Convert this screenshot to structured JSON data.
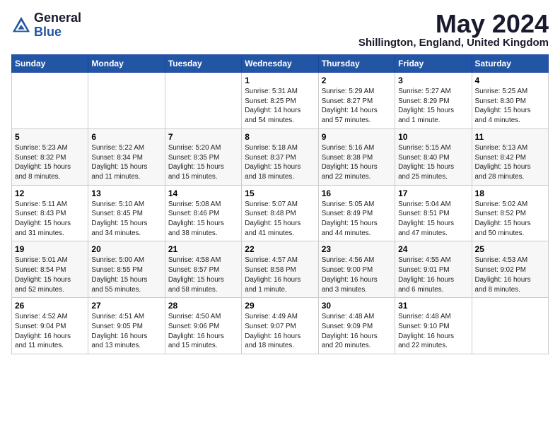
{
  "logo": {
    "general": "General",
    "blue": "Blue"
  },
  "title": "May 2024",
  "location": "Shillington, England, United Kingdom",
  "days_of_week": [
    "Sunday",
    "Monday",
    "Tuesday",
    "Wednesday",
    "Thursday",
    "Friday",
    "Saturday"
  ],
  "weeks": [
    [
      {
        "day": "",
        "info": ""
      },
      {
        "day": "",
        "info": ""
      },
      {
        "day": "",
        "info": ""
      },
      {
        "day": "1",
        "info": "Sunrise: 5:31 AM\nSunset: 8:25 PM\nDaylight: 14 hours\nand 54 minutes."
      },
      {
        "day": "2",
        "info": "Sunrise: 5:29 AM\nSunset: 8:27 PM\nDaylight: 14 hours\nand 57 minutes."
      },
      {
        "day": "3",
        "info": "Sunrise: 5:27 AM\nSunset: 8:29 PM\nDaylight: 15 hours\nand 1 minute."
      },
      {
        "day": "4",
        "info": "Sunrise: 5:25 AM\nSunset: 8:30 PM\nDaylight: 15 hours\nand 4 minutes."
      }
    ],
    [
      {
        "day": "5",
        "info": "Sunrise: 5:23 AM\nSunset: 8:32 PM\nDaylight: 15 hours\nand 8 minutes."
      },
      {
        "day": "6",
        "info": "Sunrise: 5:22 AM\nSunset: 8:34 PM\nDaylight: 15 hours\nand 11 minutes."
      },
      {
        "day": "7",
        "info": "Sunrise: 5:20 AM\nSunset: 8:35 PM\nDaylight: 15 hours\nand 15 minutes."
      },
      {
        "day": "8",
        "info": "Sunrise: 5:18 AM\nSunset: 8:37 PM\nDaylight: 15 hours\nand 18 minutes."
      },
      {
        "day": "9",
        "info": "Sunrise: 5:16 AM\nSunset: 8:38 PM\nDaylight: 15 hours\nand 22 minutes."
      },
      {
        "day": "10",
        "info": "Sunrise: 5:15 AM\nSunset: 8:40 PM\nDaylight: 15 hours\nand 25 minutes."
      },
      {
        "day": "11",
        "info": "Sunrise: 5:13 AM\nSunset: 8:42 PM\nDaylight: 15 hours\nand 28 minutes."
      }
    ],
    [
      {
        "day": "12",
        "info": "Sunrise: 5:11 AM\nSunset: 8:43 PM\nDaylight: 15 hours\nand 31 minutes."
      },
      {
        "day": "13",
        "info": "Sunrise: 5:10 AM\nSunset: 8:45 PM\nDaylight: 15 hours\nand 34 minutes."
      },
      {
        "day": "14",
        "info": "Sunrise: 5:08 AM\nSunset: 8:46 PM\nDaylight: 15 hours\nand 38 minutes."
      },
      {
        "day": "15",
        "info": "Sunrise: 5:07 AM\nSunset: 8:48 PM\nDaylight: 15 hours\nand 41 minutes."
      },
      {
        "day": "16",
        "info": "Sunrise: 5:05 AM\nSunset: 8:49 PM\nDaylight: 15 hours\nand 44 minutes."
      },
      {
        "day": "17",
        "info": "Sunrise: 5:04 AM\nSunset: 8:51 PM\nDaylight: 15 hours\nand 47 minutes."
      },
      {
        "day": "18",
        "info": "Sunrise: 5:02 AM\nSunset: 8:52 PM\nDaylight: 15 hours\nand 50 minutes."
      }
    ],
    [
      {
        "day": "19",
        "info": "Sunrise: 5:01 AM\nSunset: 8:54 PM\nDaylight: 15 hours\nand 52 minutes."
      },
      {
        "day": "20",
        "info": "Sunrise: 5:00 AM\nSunset: 8:55 PM\nDaylight: 15 hours\nand 55 minutes."
      },
      {
        "day": "21",
        "info": "Sunrise: 4:58 AM\nSunset: 8:57 PM\nDaylight: 15 hours\nand 58 minutes."
      },
      {
        "day": "22",
        "info": "Sunrise: 4:57 AM\nSunset: 8:58 PM\nDaylight: 16 hours\nand 1 minute."
      },
      {
        "day": "23",
        "info": "Sunrise: 4:56 AM\nSunset: 9:00 PM\nDaylight: 16 hours\nand 3 minutes."
      },
      {
        "day": "24",
        "info": "Sunrise: 4:55 AM\nSunset: 9:01 PM\nDaylight: 16 hours\nand 6 minutes."
      },
      {
        "day": "25",
        "info": "Sunrise: 4:53 AM\nSunset: 9:02 PM\nDaylight: 16 hours\nand 8 minutes."
      }
    ],
    [
      {
        "day": "26",
        "info": "Sunrise: 4:52 AM\nSunset: 9:04 PM\nDaylight: 16 hours\nand 11 minutes."
      },
      {
        "day": "27",
        "info": "Sunrise: 4:51 AM\nSunset: 9:05 PM\nDaylight: 16 hours\nand 13 minutes."
      },
      {
        "day": "28",
        "info": "Sunrise: 4:50 AM\nSunset: 9:06 PM\nDaylight: 16 hours\nand 15 minutes."
      },
      {
        "day": "29",
        "info": "Sunrise: 4:49 AM\nSunset: 9:07 PM\nDaylight: 16 hours\nand 18 minutes."
      },
      {
        "day": "30",
        "info": "Sunrise: 4:48 AM\nSunset: 9:09 PM\nDaylight: 16 hours\nand 20 minutes."
      },
      {
        "day": "31",
        "info": "Sunrise: 4:48 AM\nSunset: 9:10 PM\nDaylight: 16 hours\nand 22 minutes."
      },
      {
        "day": "",
        "info": ""
      }
    ]
  ]
}
